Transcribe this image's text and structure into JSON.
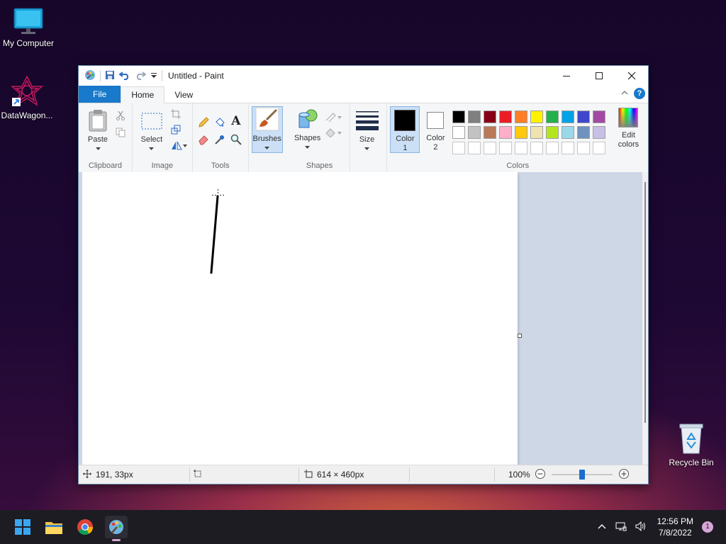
{
  "desktop": {
    "icons": [
      {
        "label": "My Computer"
      },
      {
        "label": "DataWagon..."
      },
      {
        "label": "Recycle Bin"
      }
    ]
  },
  "window": {
    "title": "Untitled - Paint",
    "tabs": {
      "file": "File",
      "home": "Home",
      "view": "View"
    }
  },
  "ribbon": {
    "clipboard": {
      "paste": "Paste",
      "group": "Clipboard"
    },
    "image": {
      "select": "Select",
      "group": "Image"
    },
    "tools": {
      "group": "Tools"
    },
    "brushes": {
      "label": "Brushes"
    },
    "shapes": {
      "label": "Shapes",
      "group": "Shapes"
    },
    "size": {
      "label": "Size"
    },
    "colors": {
      "color1_line1": "Color",
      "color1_line2": "1",
      "color2_line1": "Color",
      "color2_line2": "2",
      "edit_line1": "Edit",
      "edit_line2": "colors",
      "group": "Colors",
      "color1": "#000000",
      "color2": "#ffffff",
      "palette_row1": [
        "#000000",
        "#7f7f7f",
        "#880015",
        "#ed1c24",
        "#ff7f27",
        "#fff200",
        "#22b14c",
        "#00a2e8",
        "#3f48cc",
        "#a349a4"
      ],
      "palette_row2": [
        "#ffffff",
        "#c3c3c3",
        "#b97a57",
        "#ffaec9",
        "#ffc90e",
        "#efe4b0",
        "#b5e61d",
        "#99d9ea",
        "#7092be",
        "#c8bfe7"
      ],
      "palette_row3": [
        "",
        "",
        "",
        "",
        "",
        "",
        "",
        "",
        "",
        ""
      ]
    }
  },
  "status": {
    "cursor_pos": "191, 33px",
    "canvas_size": "614 × 460px",
    "zoom": "100%",
    "zoom_level": 0.5
  },
  "taskbar": {
    "time": "12:56 PM",
    "date": "7/8/2022",
    "notifications": "1"
  }
}
